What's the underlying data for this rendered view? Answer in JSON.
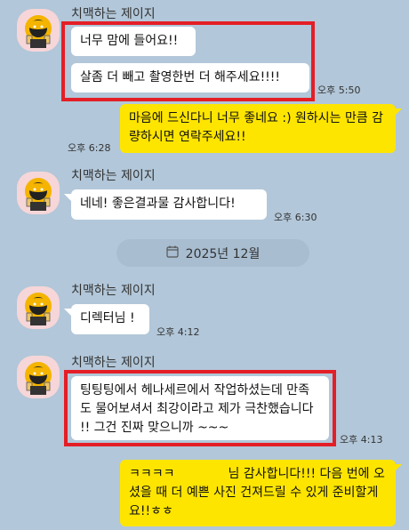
{
  "sender_name": "치맥하는 제이지",
  "messages": {
    "m1_line1": "너무 맘에 들어요!!",
    "m1_line2": "살좀 더 빼고 촬영한번 더 해주세요!!!!",
    "m1_time": "오후 5:50",
    "m2_text": "마음에 드신다니 너무 좋네요 :) 원하시는 만큼 감량하시면 연락주세요!!",
    "m2_time": "오후 6:28",
    "m3_text": "네네! 좋은결과물 감사합니다!",
    "m3_time": "오후 6:30",
    "m4_text": "디렉터님 !",
    "m4_time": "오후 4:12",
    "m5_text": "팅팅팅에서 헤나세르에서 작업하셨는데 만족도 물어보셔서 최강이라고 제가 극찬했습니다 !! 그건 진짜 맞으니까 ~~~",
    "m5_time": "오후 4:13",
    "m6_pre": "ㅋㅋㅋㅋ",
    "m6_text": "님 감사합니다!!! 다음 번에 오셨을 때 더 예쁜 사진 건져드릴 수 있게 준비할게요!!ㅎㅎ"
  },
  "date_divider": "2025년 12월",
  "icons": {
    "avatar": "ryan-beer-avatar",
    "calendar": "calendar-icon"
  },
  "colors": {
    "background": "#b2c7d9",
    "my_bubble": "#fee500",
    "other_bubble": "#ffffff",
    "highlight": "#e41e26"
  }
}
